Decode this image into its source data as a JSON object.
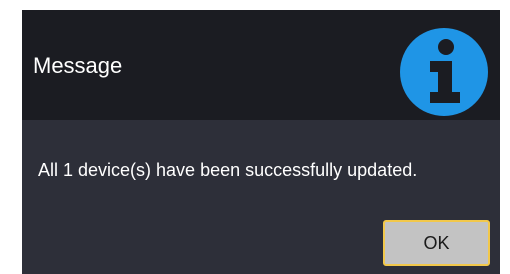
{
  "dialog": {
    "title": "Message",
    "icon": "info-icon",
    "message": "All 1 device(s) have been successfully updated.",
    "ok_label": "OK",
    "colors": {
      "header_background": "#1b1c22",
      "body_background": "#2d2f39",
      "icon_color": "#1f95e6",
      "button_background": "#c3c3c3",
      "button_focus_border": "#f2c84b"
    }
  }
}
